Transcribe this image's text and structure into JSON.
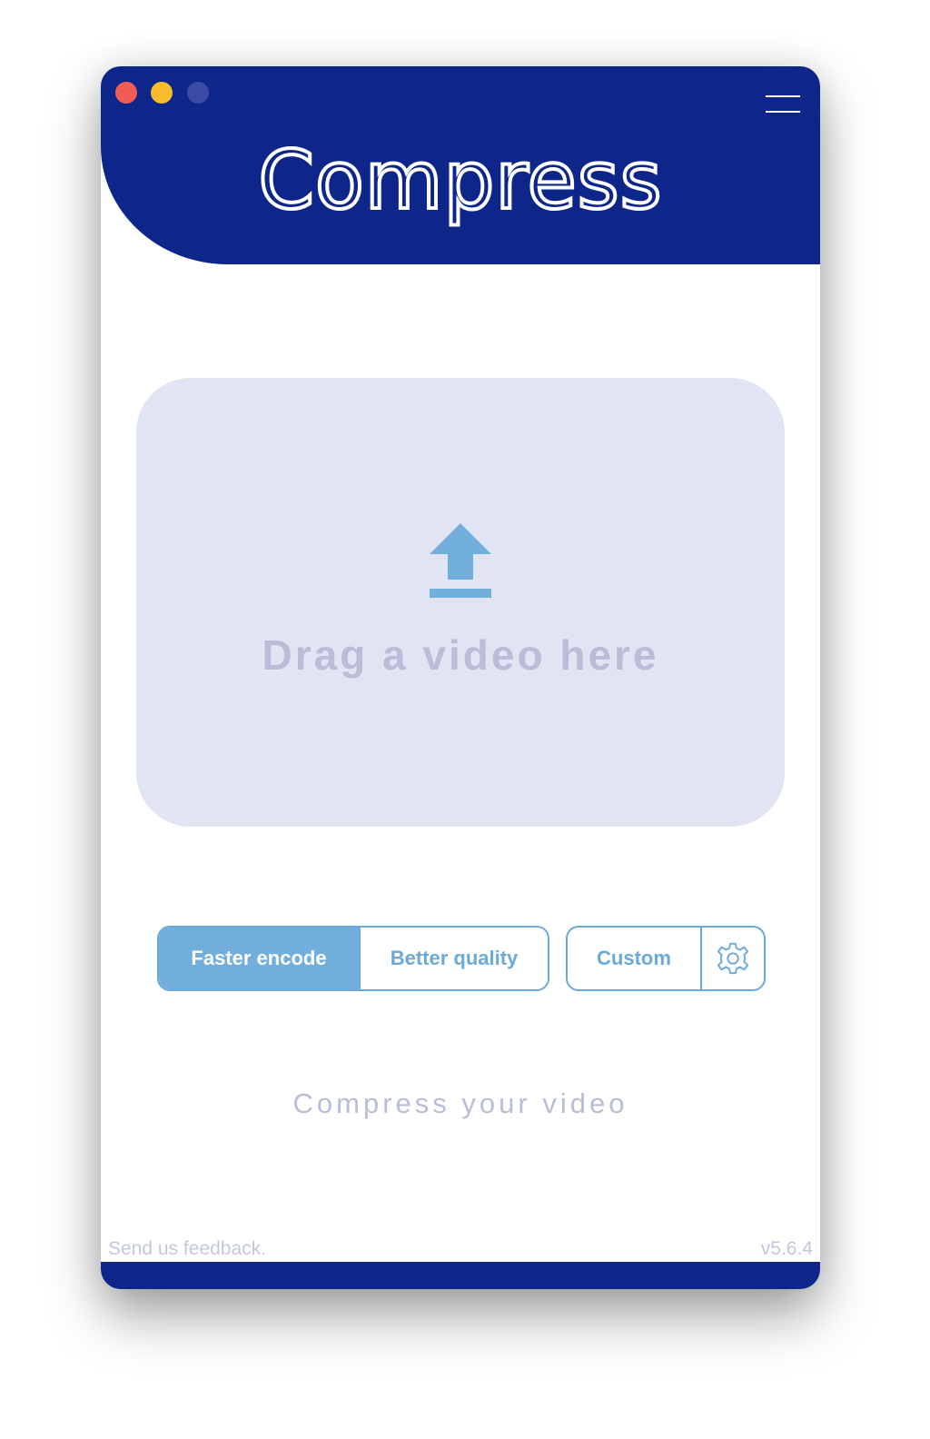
{
  "app": {
    "name": "Compress"
  },
  "window": {
    "traffic_lights": [
      "close",
      "minimize",
      "maximize"
    ],
    "menu_icon": "hamburger-menu-icon"
  },
  "colors": {
    "header": "#0e258a",
    "accent": "#72aedc",
    "dropzone": "#e0e4f3",
    "muted_text": "#b9bdd8"
  },
  "dropzone": {
    "icon": "upload-arrow-icon",
    "label": "Drag a video here"
  },
  "presets": {
    "options": [
      "Faster encode",
      "Better quality"
    ],
    "selected": "Faster encode",
    "custom_label": "Custom",
    "settings_icon": "gear-icon"
  },
  "tagline": "Compress your video",
  "footer": {
    "feedback_link": "Send us feedback.",
    "version": "v5.6.4"
  }
}
